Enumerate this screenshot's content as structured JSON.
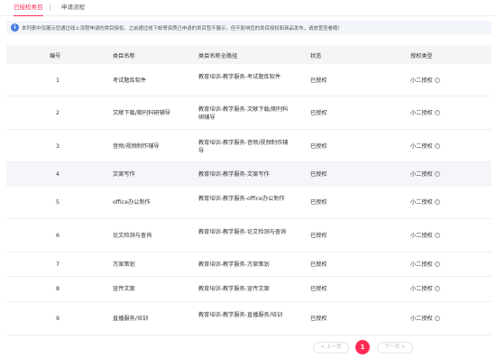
{
  "tabs": {
    "authorized": "已授权类目",
    "apply": "申请流程"
  },
  "notice": {
    "icon": "info-icon",
    "text": "本列表中仅展示您通过线上流程申请的类目授权。之前通过线下邮寄资质已申请的类目暂不展示，但不影响您的类目授权和商品发布，请放宽查看哦!"
  },
  "table": {
    "headers": {
      "no": "编号",
      "name": "类目名称",
      "path": "类目名称全路径",
      "status": "状态",
      "type": "授权类型"
    },
    "rows": [
      {
        "no": "1",
        "name": "考试题库软件",
        "path": "教育培训-教学服务-考试题库软件",
        "status": "已授权",
        "type": "小二授权"
      },
      {
        "no": "2",
        "name": "文献下载/期刊科研辅导",
        "path": "教育培训-教学服务-文献下载/期刊科研辅导",
        "status": "已授权",
        "type": "小二授权"
      },
      {
        "no": "3",
        "name": "音频/视频制作辅导",
        "path": "教育培训-教学服务-音频/视频制作辅导",
        "status": "已授权",
        "type": "小二授权"
      },
      {
        "no": "4",
        "name": "文案写作",
        "path": "教育培训-教学服务-文案写作",
        "status": "已授权",
        "type": "小二授权"
      },
      {
        "no": "5",
        "name": "office办公制作",
        "path": "教育培训-教学服务-office办公制作",
        "status": "已授权",
        "type": "小二授权"
      },
      {
        "no": "6",
        "name": "论文检测与查询",
        "path": "教育培训-教学服务-论文检测与查询",
        "status": "已授权",
        "type": "小二授权"
      },
      {
        "no": "7",
        "name": "方案策划",
        "path": "教育培训-教学服务-方案策划",
        "status": "已授权",
        "type": "小二授权"
      },
      {
        "no": "8",
        "name": "宣传文案",
        "path": "教育培训-教学服务-宣传文案",
        "status": "已授权",
        "type": "小二授权"
      },
      {
        "no": "9",
        "name": "直播服务/培训",
        "path": "教育培训-教学服务-直播服务/培训",
        "status": "已授权",
        "type": "小二授权"
      }
    ]
  },
  "pagination": {
    "prev": "< 上一页",
    "current": "1",
    "next": "下一页 >"
  },
  "colors": {
    "accent": "#ff2d55",
    "info": "#4a7ee0",
    "row_highlight": "#f5f6f9"
  }
}
